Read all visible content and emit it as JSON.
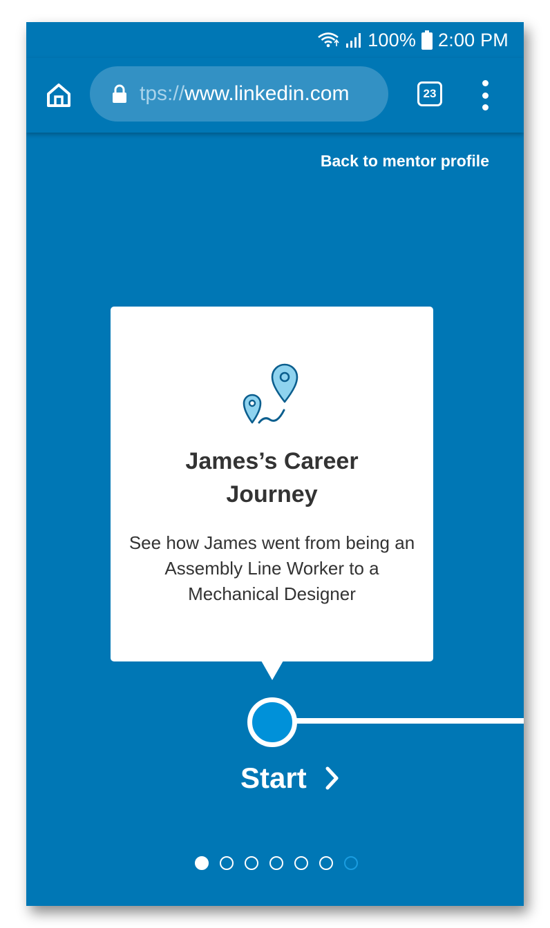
{
  "status_bar": {
    "battery": "100%",
    "time": "2:00 PM",
    "icons": [
      "wifi-icon",
      "signal-icon",
      "battery-icon"
    ]
  },
  "browser": {
    "url_prefix": "tps://",
    "url_host": "www.linkedin.com",
    "tab_count": "23",
    "icons": [
      "home-icon",
      "lock-icon",
      "tabs-icon",
      "more-vert-icon"
    ]
  },
  "page": {
    "back_link": "Back to mentor profile",
    "card": {
      "title": "James’s Career Journey",
      "description": "See how James went from being an Assembly Line Worker to a Mechanical Designer",
      "icon": "map-pins-icon"
    },
    "start_label": "Start",
    "pagination": {
      "total": 7,
      "current": 1
    }
  },
  "colors": {
    "background": "#0077b5",
    "url_pill": "#3391c4",
    "node": "#0091d9",
    "text_dark": "#333333"
  }
}
